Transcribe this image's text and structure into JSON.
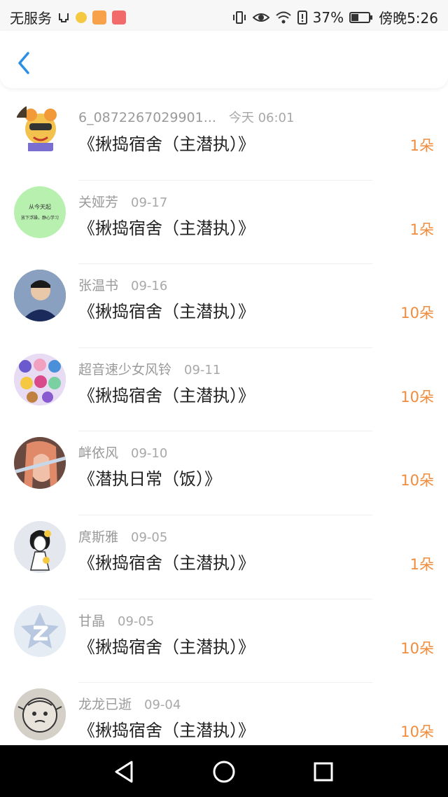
{
  "status_bar": {
    "carrier": "无服务",
    "battery": "37%",
    "time": "傍晚5:26"
  },
  "list": [
    {
      "name": "6_0872267029901...",
      "date": "今天 06:01",
      "title": "《揪捣宿舍（主潜执）》",
      "amount": "1朵"
    },
    {
      "name": "关娅芳",
      "date": "09-17",
      "title": "《揪捣宿舍（主潜执）》",
      "amount": "1朵",
      "avatar_text1": "从今天起",
      "avatar_text2": "放下浮躁，静心学习"
    },
    {
      "name": "张温书",
      "date": "09-16",
      "title": "《揪捣宿舍（主潜执）》",
      "amount": "10朵"
    },
    {
      "name": "超音速少女风铃",
      "date": "09-11",
      "title": "《揪捣宿舍（主潜执）》",
      "amount": "10朵"
    },
    {
      "name": "衅依风",
      "date": "09-10",
      "title": "《潜执日常（饭）》",
      "amount": "10朵"
    },
    {
      "name": "庹斯雅",
      "date": "09-05",
      "title": "《揪捣宿舍（主潜执）》",
      "amount": "1朵"
    },
    {
      "name": "甘晶",
      "date": "09-05",
      "title": "《揪捣宿舍（主潜执）》",
      "amount": "10朵"
    },
    {
      "name": "龙龙已逝",
      "date": "09-04",
      "title": "《揪捣宿舍（主潜执）》",
      "amount": "10朵"
    }
  ],
  "colors": {
    "accent_blue": "#2b8fe6",
    "amount_orange": "#f08c3c",
    "meta_gray": "#9a9a9a"
  }
}
